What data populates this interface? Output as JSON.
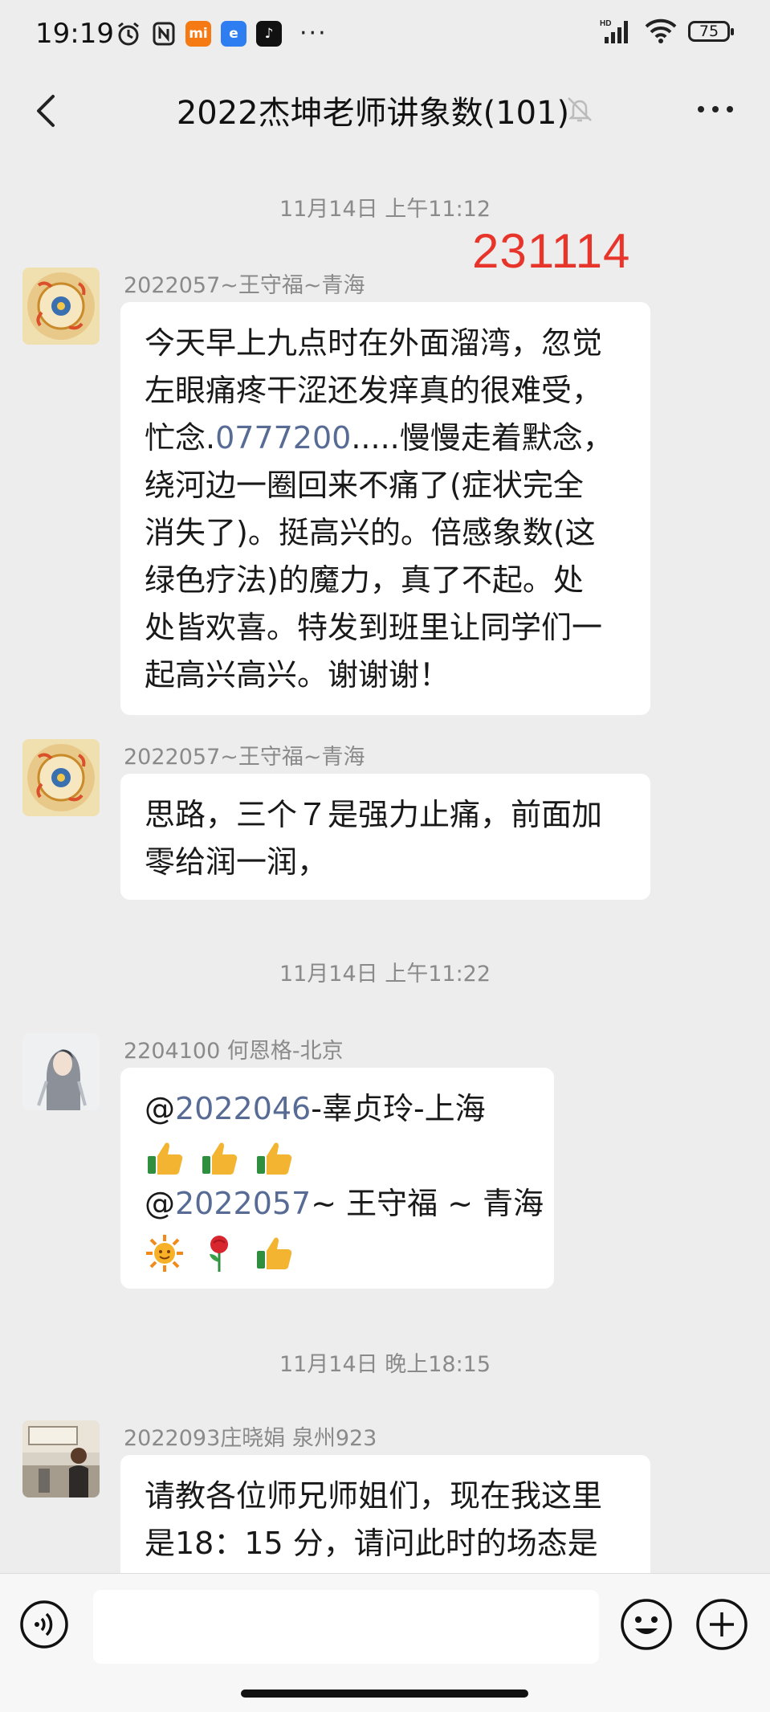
{
  "status_bar": {
    "time": "19:19",
    "battery": "75",
    "signal_label": "HD"
  },
  "header": {
    "title": "2022杰坤老师讲象数(101)"
  },
  "stamp": "231114",
  "messages": [
    {
      "timestamp": "11月14日 上午11:12"
    },
    {
      "sender": "2022057~王守福~青海",
      "lines": [
        "今天早上九点时在外面溜湾，忽觉",
        "左眼痛疼干涩还发痒真的很难受，",
        "......",
        "绕河边一圈回来不痛了(症状完全",
        "消失了)。挺高兴的。倍感象数(这",
        "绿色疗法)的魔力，真了不起。处",
        "处皆欢喜。特发到班里让同学们一",
        "起高兴高兴。谢谢谢！"
      ],
      "line3_pre": "忙念.",
      "line3_link": "0777200",
      "line3_post": ".....慢慢走着默念，"
    },
    {
      "sender": "2022057~王守福~青海",
      "lines": [
        "思路，三个７是强力止痛，前面加",
        "零给润一润，"
      ]
    },
    {
      "timestamp": "11月14日 上午11:22"
    },
    {
      "sender": "2204100 何恩格-北京",
      "mention1_at": "@",
      "mention1_num": "2022046",
      "mention1_rest": "-辜贞玲-上海",
      "mention2_at": "@",
      "mention2_num": "2022057",
      "mention2_rest": "~ 王守福 ~ 青海",
      "emoji_row1": [
        "thumbs-up",
        "thumbs-up",
        "thumbs-up"
      ],
      "emoji_row2": [
        "sun",
        "rose",
        "thumbs-up"
      ]
    },
    {
      "timestamp": "11月14日 晚上18:15"
    },
    {
      "sender": "2022093庄晓娟 泉州923",
      "lines": [
        "请教各位师兄师姐们，现在我这里",
        "是18：15 分，请问此时的场态是"
      ]
    }
  ],
  "colors": {
    "background": "#ededed",
    "bubble": "#ffffff",
    "link": "#576b95",
    "stamp": "#e8352b"
  }
}
